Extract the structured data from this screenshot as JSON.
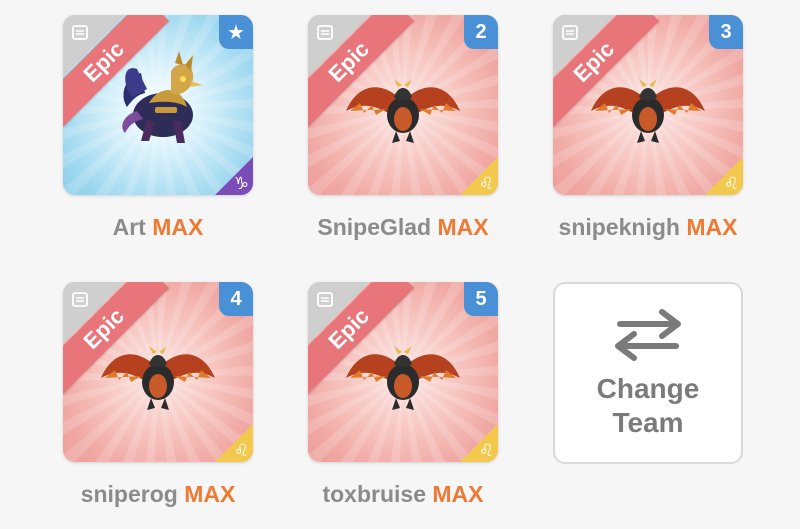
{
  "team": [
    {
      "name": "Art",
      "level": "MAX",
      "rarity": "Epic",
      "badge": "★",
      "badge_icon": "star-icon",
      "element": "♑",
      "element_icon": "capricorn-icon",
      "theme": "dark",
      "monster": "dark-griffin"
    },
    {
      "name": "SnipeGlad",
      "level": "MAX",
      "rarity": "Epic",
      "badge": "2",
      "element": "♌",
      "element_icon": "leo-icon",
      "theme": "fire",
      "monster": "fire-dragon"
    },
    {
      "name": "snipeknigh",
      "level": "MAX",
      "rarity": "Epic",
      "badge": "3",
      "element": "♌",
      "element_icon": "leo-icon",
      "theme": "fire",
      "monster": "fire-dragon"
    },
    {
      "name": "sniperog",
      "level": "MAX",
      "rarity": "Epic",
      "badge": "4",
      "element": "♌",
      "element_icon": "leo-icon",
      "theme": "fire",
      "monster": "fire-dragon"
    },
    {
      "name": "toxbruise",
      "level": "MAX",
      "rarity": "Epic",
      "badge": "5",
      "element": "♌",
      "element_icon": "leo-icon",
      "theme": "fire",
      "monster": "fire-dragon"
    }
  ],
  "change_team": {
    "line1": "Change",
    "line2": "Team"
  },
  "colors": {
    "max_text": "#ee7a34",
    "name_text": "#8b8b8b",
    "ribbon": "#e8757a",
    "badge": "#4a90d6",
    "leo_corner": "#f2c94c",
    "capricorn_corner": "#7b4bb8"
  }
}
